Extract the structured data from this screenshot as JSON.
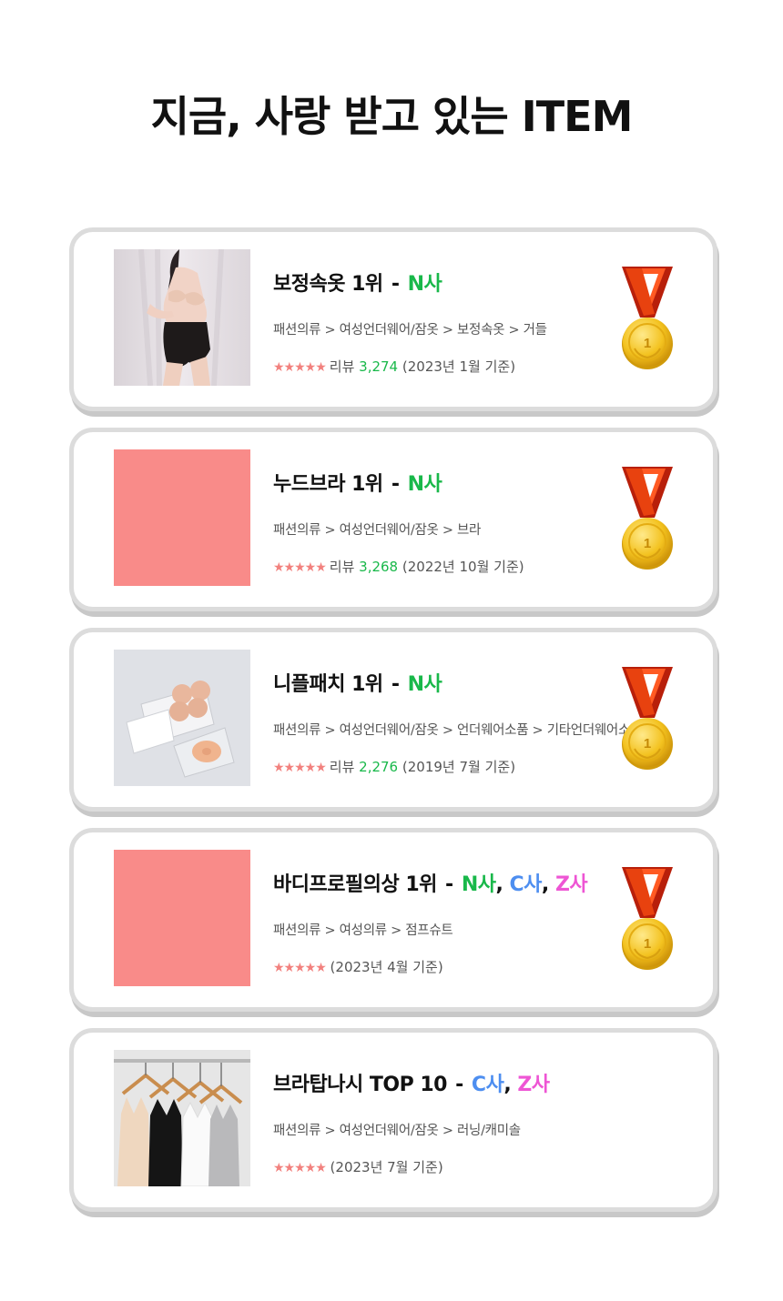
{
  "page": {
    "title": "지금, 사랑 받고 있는 ITEM"
  },
  "items": [
    {
      "name": "보정속옷 1위",
      "dash": " - ",
      "companies": [
        {
          "label": "N사",
          "color": "#19b84a"
        }
      ],
      "category": "패션의류 > 여성언더웨어/잠옷 > 보정속옷 > 거들",
      "stars": "★★★★★",
      "review_label": "리뷰",
      "review_count": "3,274",
      "basis": "(2023년 1월 기준)",
      "image": "photo-model"
    },
    {
      "name": "누드브라 1위",
      "dash": " - ",
      "companies": [
        {
          "label": "N사",
          "color": "#19b84a"
        }
      ],
      "category": "패션의류 > 여성언더웨어/잠옷 > 브라",
      "stars": "★★★★★",
      "review_label": "리뷰",
      "review_count": "3,268",
      "basis": "(2022년 10월 기준)",
      "image": "placeholder"
    },
    {
      "name": "니플패치 1위",
      "dash": " - ",
      "companies": [
        {
          "label": "N사",
          "color": "#19b84a"
        }
      ],
      "category": "패션의류 > 여성언더웨어/잠옷 > 언더웨어소품 > 기타언더웨어소품",
      "stars": "★★★★★",
      "review_label": "리뷰",
      "review_count": "2,276",
      "basis": "(2019년 7월 기준)",
      "image": "photo-patch"
    },
    {
      "name": "바디프로필의상 1위",
      "dash": " - ",
      "companies": [
        {
          "label": "N사",
          "color": "#19b84a"
        },
        {
          "label": "C사",
          "color": "#4d8ef0"
        },
        {
          "label": "Z사",
          "color": "#ee55d4"
        }
      ],
      "category": "패션의류 > 여성의류 > 점프슈트",
      "stars": "★★★★★",
      "review_label": "",
      "review_count": "",
      "basis": "(2023년 4월 기준)",
      "image": "placeholder"
    },
    {
      "name": "브라탑나시 TOP 10",
      "dash": " - ",
      "companies": [
        {
          "label": "C사",
          "color": "#4d8ef0"
        },
        {
          "label": "Z사",
          "color": "#ee55d4"
        }
      ],
      "category": "패션의류 > 여성언더웨어/잠옷 > 러닝/캐미솔",
      "stars": "★★★★★",
      "review_label": "",
      "review_count": "",
      "basis": "(2023년 7월 기준)",
      "image": "photo-tanks"
    }
  ],
  "medal": {
    "number": "1",
    "icon": "gold-medal-icon"
  }
}
